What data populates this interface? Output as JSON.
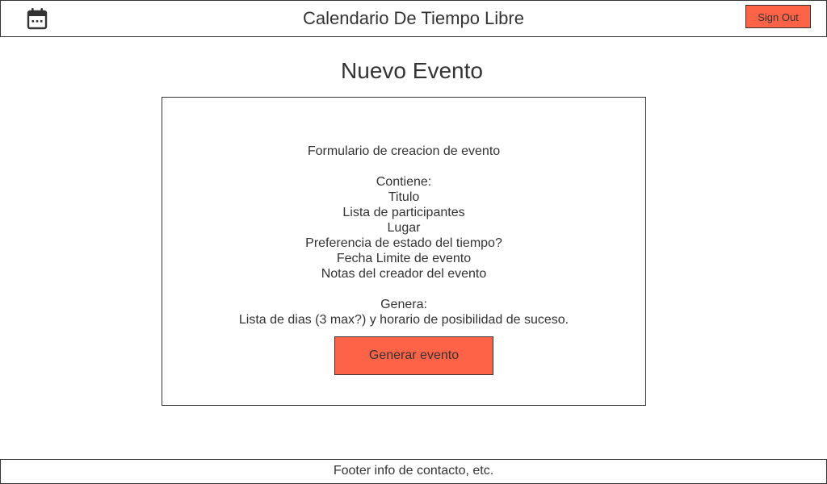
{
  "header": {
    "icon": "calendar-icon",
    "title": "Calendario De Tiempo Libre",
    "signout_label": "Sign Out"
  },
  "main": {
    "heading": "Nuevo Evento",
    "form": {
      "intro": "Formulario de creacion de evento",
      "contains_label": "Contiene:",
      "contains_items": [
        "Titulo",
        "Lista de participantes",
        "Lugar",
        "Preferencia de estado del tiempo?",
        "Fecha Limite de evento",
        "Notas del creador del evento"
      ],
      "generates_label": "Genera:",
      "generates_text": "Lista de dias (3 max?) y horario de posibilidad de suceso.",
      "button_label": "Generar evento"
    }
  },
  "footer": {
    "text": "Footer info de contacto, etc."
  },
  "colors": {
    "accent": "#ff6347",
    "border": "#333333",
    "text": "#333333",
    "background": "#ffffff"
  }
}
